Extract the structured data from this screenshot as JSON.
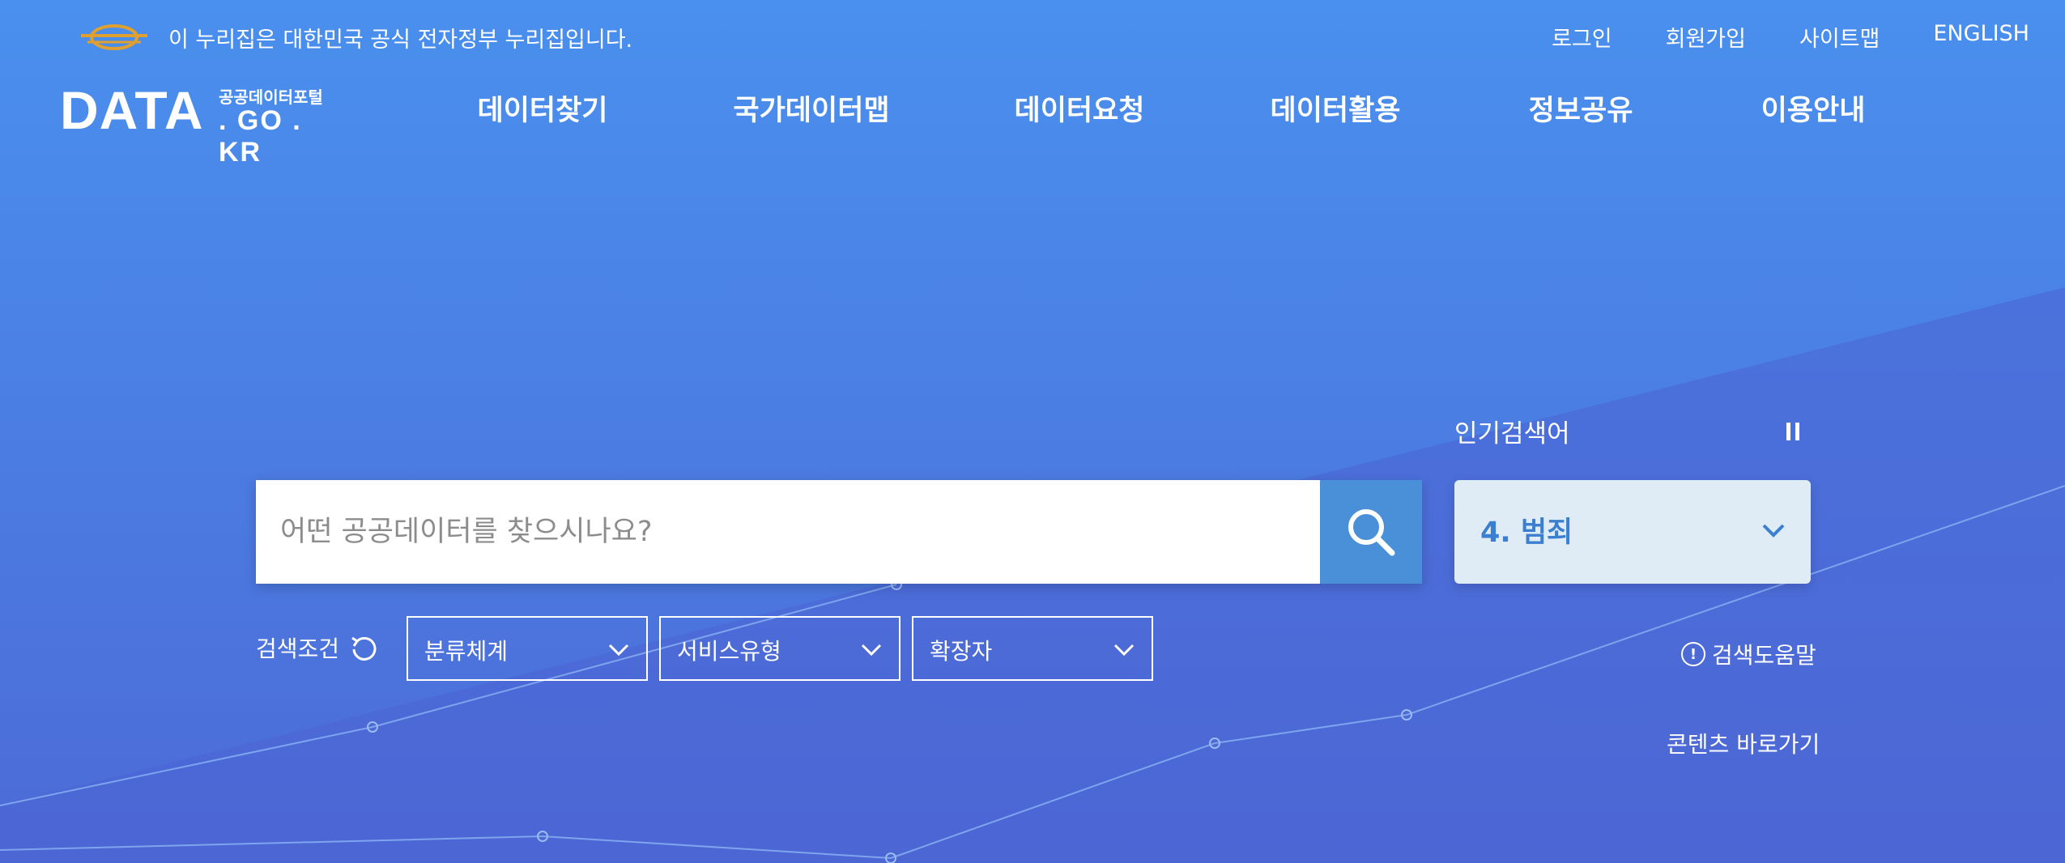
{
  "gov_banner": {
    "text": "이 누리집은 대한민국 공식 전자정부 누리집입니다.",
    "icon": "egov-emblem-icon"
  },
  "util_links": [
    "로그인",
    "회원가입",
    "사이트맵",
    "ENGLISH"
  ],
  "logo": {
    "main": "DATA",
    "sub": "공공데이터포털",
    "domain": ". GO . KR"
  },
  "gnb": [
    "데이터찾기",
    "국가데이터맵",
    "데이터요청",
    "데이터활용",
    "정보공유",
    "이용안내"
  ],
  "search": {
    "placeholder": "어떤 공공데이터를 찾으시나요?",
    "value": ""
  },
  "popular": {
    "label": "인기검색어",
    "current": "4. 범죄"
  },
  "conditions": {
    "label": "검색조건",
    "selects": [
      "분류체계",
      "서비스유형",
      "확장자"
    ]
  },
  "help_label": "검색도움말",
  "shortcut_label": "콘텐츠 바로가기",
  "colors": {
    "background": "#4a86ea",
    "search_button": "#4a90d9",
    "popular_text": "#3a7fd0",
    "emblem": "#e0a030"
  }
}
